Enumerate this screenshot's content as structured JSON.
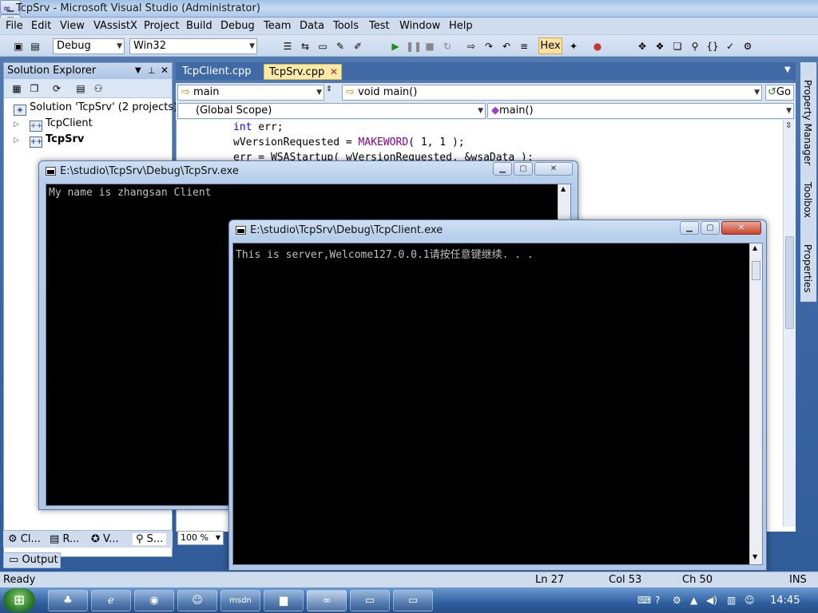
{
  "window": {
    "title": "TcpSrv - Microsoft Visual Studio (Administrator)"
  },
  "menu": [
    "File",
    "Edit",
    "View",
    "VAssistX",
    "Project",
    "Build",
    "Debug",
    "Team",
    "Data",
    "Tools",
    "Test",
    "Window",
    "Help"
  ],
  "toolbar": {
    "config": "Debug",
    "platform": "Win32",
    "hex_label": "Hex"
  },
  "solution_explorer": {
    "title": "Solution Explorer",
    "solution": "Solution 'TcpSrv' (2 projects)",
    "projects": [
      "TcpClient",
      "TcpSrv"
    ],
    "bottom_tabs": [
      "Cl...",
      "R...",
      "V...",
      "S..."
    ]
  },
  "editor": {
    "tabs": [
      "TcpClient.cpp",
      "TcpSrv.cpp"
    ],
    "nav_left": "main",
    "nav_right": "void main()",
    "go_label": "Go",
    "scope": "(Global Scope)",
    "scope_member": "main()",
    "code_lines": [
      {
        "kw": "int",
        "rest": " err;"
      },
      {
        "pre": "wVersionRequested = ",
        "macro": "MAKEWORD",
        "rest": "( 1, 1 );"
      },
      {
        "pre": "err = WSAStartup( wVersionRequested, &wsaData );"
      }
    ],
    "zoom": "100 %"
  },
  "right_dock": [
    "Property Manager",
    "Toolbox",
    "Properties"
  ],
  "output_tab": "Output",
  "server_console": {
    "title": "E:\\studio\\TcpSrv\\Debug\\TcpSrv.exe",
    "text": "My name is zhangsan Client"
  },
  "client_console": {
    "title": "E:\\studio\\TcpSrv\\Debug\\TcpClient.exe",
    "text": "This is server,Welcome127.0.0.1请按任意键继续. . ."
  },
  "status": {
    "state": "Ready",
    "ln": "Ln 27",
    "col": "Col 53",
    "ch": "Ch 50",
    "mode": "INS"
  },
  "taskbar": {
    "clock": "14:45",
    "msdn": "msdn"
  }
}
